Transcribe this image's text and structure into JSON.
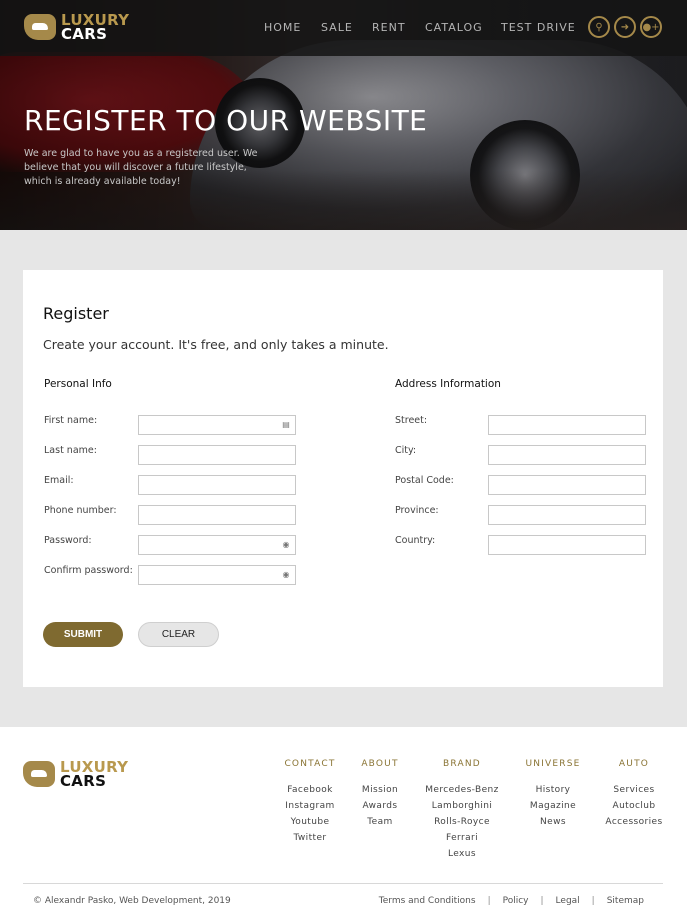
{
  "brand": {
    "line1": "LUXURY",
    "line2": "CARS"
  },
  "nav": {
    "items": [
      "HOME",
      "SALE",
      "RENT",
      "CATALOG",
      "TEST DRIVE"
    ]
  },
  "header_icons": [
    "search-icon",
    "sign-in-icon",
    "add-user-icon"
  ],
  "hero": {
    "title": "REGISTER TO OUR WEBSITE",
    "subtitle": "We are glad to have you as a registered user. We believe that you will discover a future lifestyle, which is already available today!"
  },
  "form": {
    "title": "Register",
    "intro": "Create your account. It's free, and only takes a minute.",
    "personal": {
      "title": "Personal Info",
      "fields": [
        {
          "label": "First name:",
          "value": ""
        },
        {
          "label": "Last name:",
          "value": ""
        },
        {
          "label": "Email:",
          "value": ""
        },
        {
          "label": "Phone number:",
          "value": ""
        },
        {
          "label": "Password:",
          "value": ""
        },
        {
          "label": "Confirm password:",
          "value": ""
        }
      ]
    },
    "address": {
      "title": "Address Information",
      "fields": [
        {
          "label": "Street:",
          "value": ""
        },
        {
          "label": "City:",
          "value": ""
        },
        {
          "label": "Postal Code:",
          "value": ""
        },
        {
          "label": "Province:",
          "value": ""
        },
        {
          "label": "Country:",
          "value": ""
        }
      ]
    },
    "submit_label": "SUBMIT",
    "clear_label": "CLEAR"
  },
  "footer": {
    "columns": [
      {
        "head": "CONTACT",
        "items": [
          "Facebook",
          "Instagram",
          "Youtube",
          "Twitter"
        ]
      },
      {
        "head": "ABOUT",
        "items": [
          "Mission",
          "Awards",
          "Team"
        ]
      },
      {
        "head": "BRAND",
        "items": [
          "Mercedes-Benz",
          "Lamborghini",
          "Rolls-Royce",
          "Ferrari",
          "Lexus"
        ]
      },
      {
        "head": "UNIVERSE",
        "items": [
          "History",
          "Magazine",
          "News"
        ]
      },
      {
        "head": "AUTO",
        "items": [
          "Services",
          "Autoclub",
          "Accessories"
        ]
      }
    ],
    "copyright": "© Alexandr Pasko, Web Development, 2019",
    "links": [
      "Terms and Conditions",
      "Policy",
      "Legal",
      "Sitemap"
    ]
  },
  "colors": {
    "accent": "#a5894a",
    "accent_dark": "#7f6a30",
    "page_bg": "#e6e6e6"
  }
}
